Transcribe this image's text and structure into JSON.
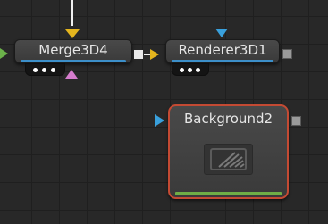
{
  "nodes": {
    "merge": {
      "title": "Merge3D4"
    },
    "renderer": {
      "title": "Renderer3D1"
    },
    "background": {
      "title": "Background2"
    }
  },
  "colors": {
    "canvas": "#282828",
    "grid": "#1f1f1f",
    "node_body": "#424242",
    "selected_border": "#c44a33",
    "input_yellow": "#e4b51e",
    "input_blue": "#39a0dc",
    "input_green": "#6bb24a",
    "input_pink": "#d57ccd",
    "output_square": "#e8e8e8",
    "output_square_idle": "#9a9a9a",
    "status_bar_blue": "#3c8fc9",
    "status_bar_green": "#6fae46"
  },
  "icons": {
    "background_thumbnail": "image-placeholder-icon",
    "status_dots": "view-indicator-dots"
  }
}
